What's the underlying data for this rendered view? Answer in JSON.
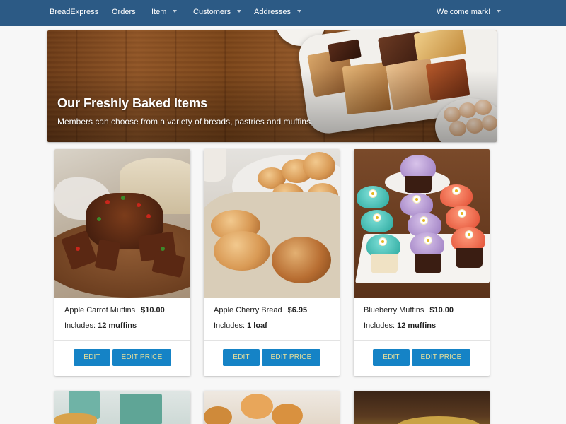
{
  "nav": {
    "brand": "BreadExpress",
    "orders": "Orders",
    "item": "Item",
    "customers": "Customers",
    "addresses": "Addresses",
    "welcome": "Welcome mark!"
  },
  "hero": {
    "title": "Our Freshly Baked Items",
    "subtitle": "Members can choose from a variety of breads, pastries and muffins."
  },
  "cards": [
    {
      "name": "Apple Carrot Muffins",
      "price": "$10.00",
      "includes_label": "Includes:",
      "includes_value": "12 muffins",
      "edit_label": "EDIT",
      "edit_price_label": "EDIT PRICE"
    },
    {
      "name": "Apple Cherry Bread",
      "price": "$6.95",
      "includes_label": "Includes:",
      "includes_value": "1 loaf",
      "edit_label": "EDIT",
      "edit_price_label": "EDIT PRICE"
    },
    {
      "name": "Blueberry Muffins",
      "price": "$10.00",
      "includes_label": "Includes:",
      "includes_value": "12 muffins",
      "edit_label": "EDIT",
      "edit_price_label": "EDIT PRICE"
    }
  ],
  "colors": {
    "navbar": "#2c5a85",
    "button": "#1583c6",
    "button_text": "#e8e09a"
  },
  "icons": [
    "caret-down-icon"
  ]
}
